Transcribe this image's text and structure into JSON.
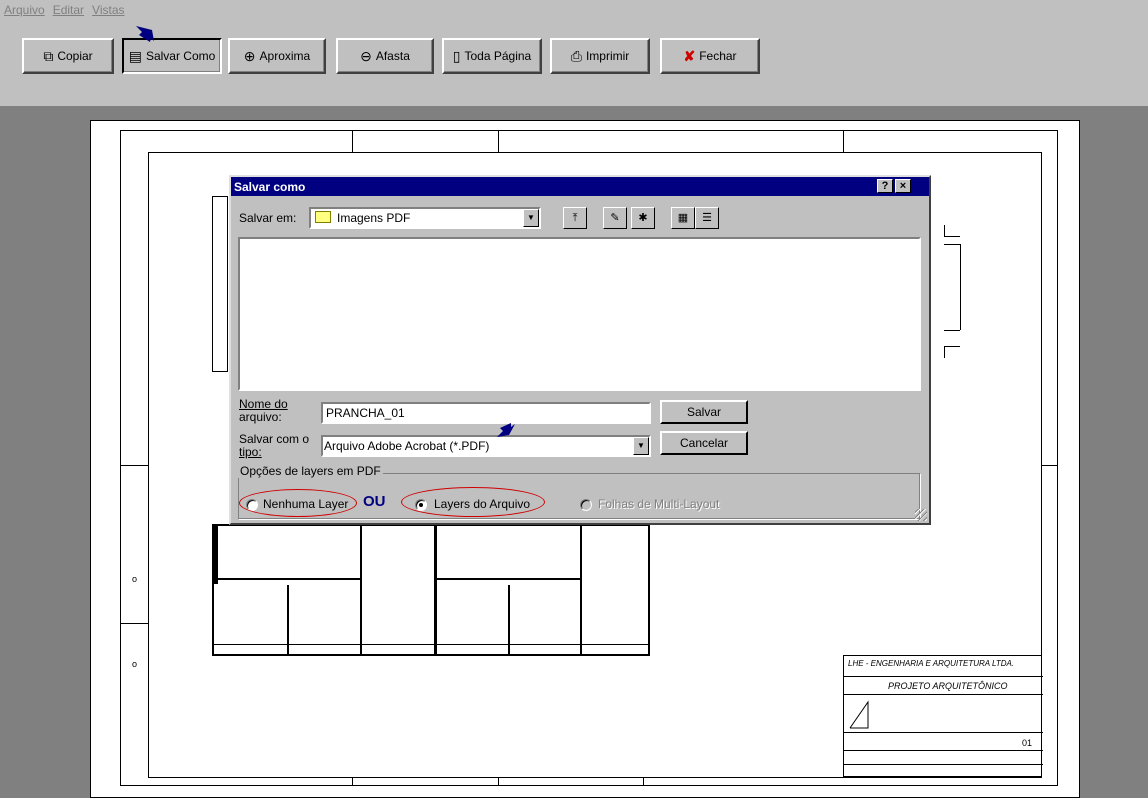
{
  "menu": [
    "Arquivo",
    "Editar",
    "Vistas"
  ],
  "toolbar": {
    "copiar": "Copiar",
    "salvar_como": "Salvar Como",
    "aproxima": "Aproxima",
    "afasta": "Afasta",
    "toda_pagina": "Toda Página",
    "imprimir": "Imprimir",
    "fechar": "Fechar"
  },
  "dialog": {
    "title": "Salvar como",
    "help_button": "?",
    "close_button": "×",
    "salvar_em_label": "Salvar em:",
    "folder": "Imagens PDF",
    "filename_label_1": "Nome do",
    "filename_label_2": "arquivo:",
    "filename_value": "PRANCHA_01",
    "filetype_label_1": "Salvar com o",
    "filetype_label_2": "tipo:",
    "filetype_value": "Arquivo Adobe Acrobat (*.PDF)",
    "salvar_button": "Salvar",
    "cancelar_button": "Cancelar",
    "group_label": "Opções de layers em PDF",
    "option_none": "Nenhuma Layer",
    "or_text": "OU",
    "option_layers": "Layers do Arquivo",
    "option_multilayout": "Folhas de Multi-Layout",
    "selected_option": "Layers do Arquivo"
  },
  "titleblock": {
    "company": "LHE - ENGENHARIA E ARQUITETURA LTDA.",
    "project": "PROJETO ARQUITETÔNICO",
    "sheet": "01"
  },
  "colors": {
    "window_bg": "#c0c0c0",
    "workspace_bg": "#808080",
    "titlebar": "#000080",
    "annotation_red": "#d00000",
    "annotation_blue": "#000080"
  }
}
